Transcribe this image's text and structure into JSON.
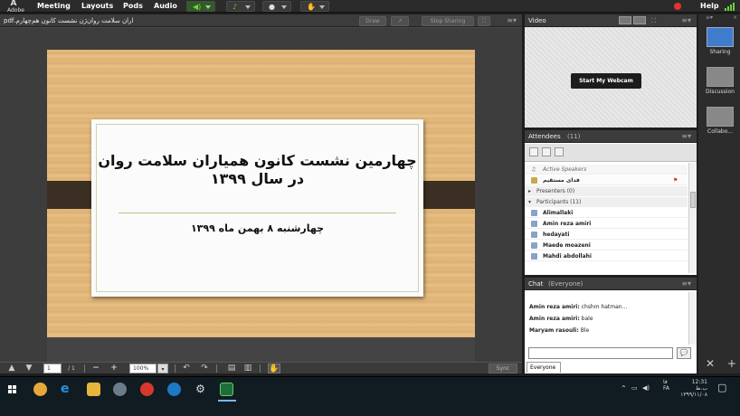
{
  "menubar": {
    "logo_text": "Adobe",
    "items": [
      "Meeting",
      "Layouts",
      "Pods",
      "Audio"
    ],
    "help": "Help"
  },
  "share_pod": {
    "filename": "اران سلامت روان‌ژن نشست کانون هم‌چهارم.pdf",
    "draw_label": "Draw",
    "stop_sharing_label": "Stop Sharing",
    "sync_label": "Sync",
    "page_current": "1",
    "page_total": "/ 1",
    "zoom": "100%"
  },
  "slide": {
    "title_line1": "چهارمین نشست کانون همیاران سلامت روان",
    "title_line2": "در سال ۱۳۹۹",
    "subtitle": "چهارشنبه ۸ بهمن ماه ۱۳۹۹"
  },
  "video_pod": {
    "title": "Video",
    "webcam_button": "Start My Webcam"
  },
  "attendees": {
    "title": "Attendees",
    "count": "(11)",
    "active_speakers": "Active Speakers",
    "speaker_name": "فدای مستقیم",
    "presenters": "Presenters (0)",
    "participants": "Participants (11)",
    "people": [
      "Alimallaki",
      "Amin reza amiri",
      "hedayati",
      "Maede moazeni",
      "Mahdi abdollahi"
    ]
  },
  "chat": {
    "title": "Chat",
    "scope": "(Everyone)",
    "messages": [
      {
        "author": "Amin reza amiri:",
        "text": "chshm hatman..."
      },
      {
        "author": "Amin reza amiri:",
        "text": "bale"
      },
      {
        "author": "Maryam rasouli:",
        "text": "Ble"
      }
    ],
    "tab": "Everyone"
  },
  "layouts": {
    "items": [
      "Sharing",
      "Discussion",
      "Collabo..."
    ]
  },
  "taskbar": {
    "time": "12:31 ب.ظ",
    "date": "۱۳۹۹/۱۱/۰۸",
    "lang": "FA",
    "lang2": "فا"
  },
  "colors": {
    "accent": "#3f7ccc",
    "record": "#e3342f"
  }
}
